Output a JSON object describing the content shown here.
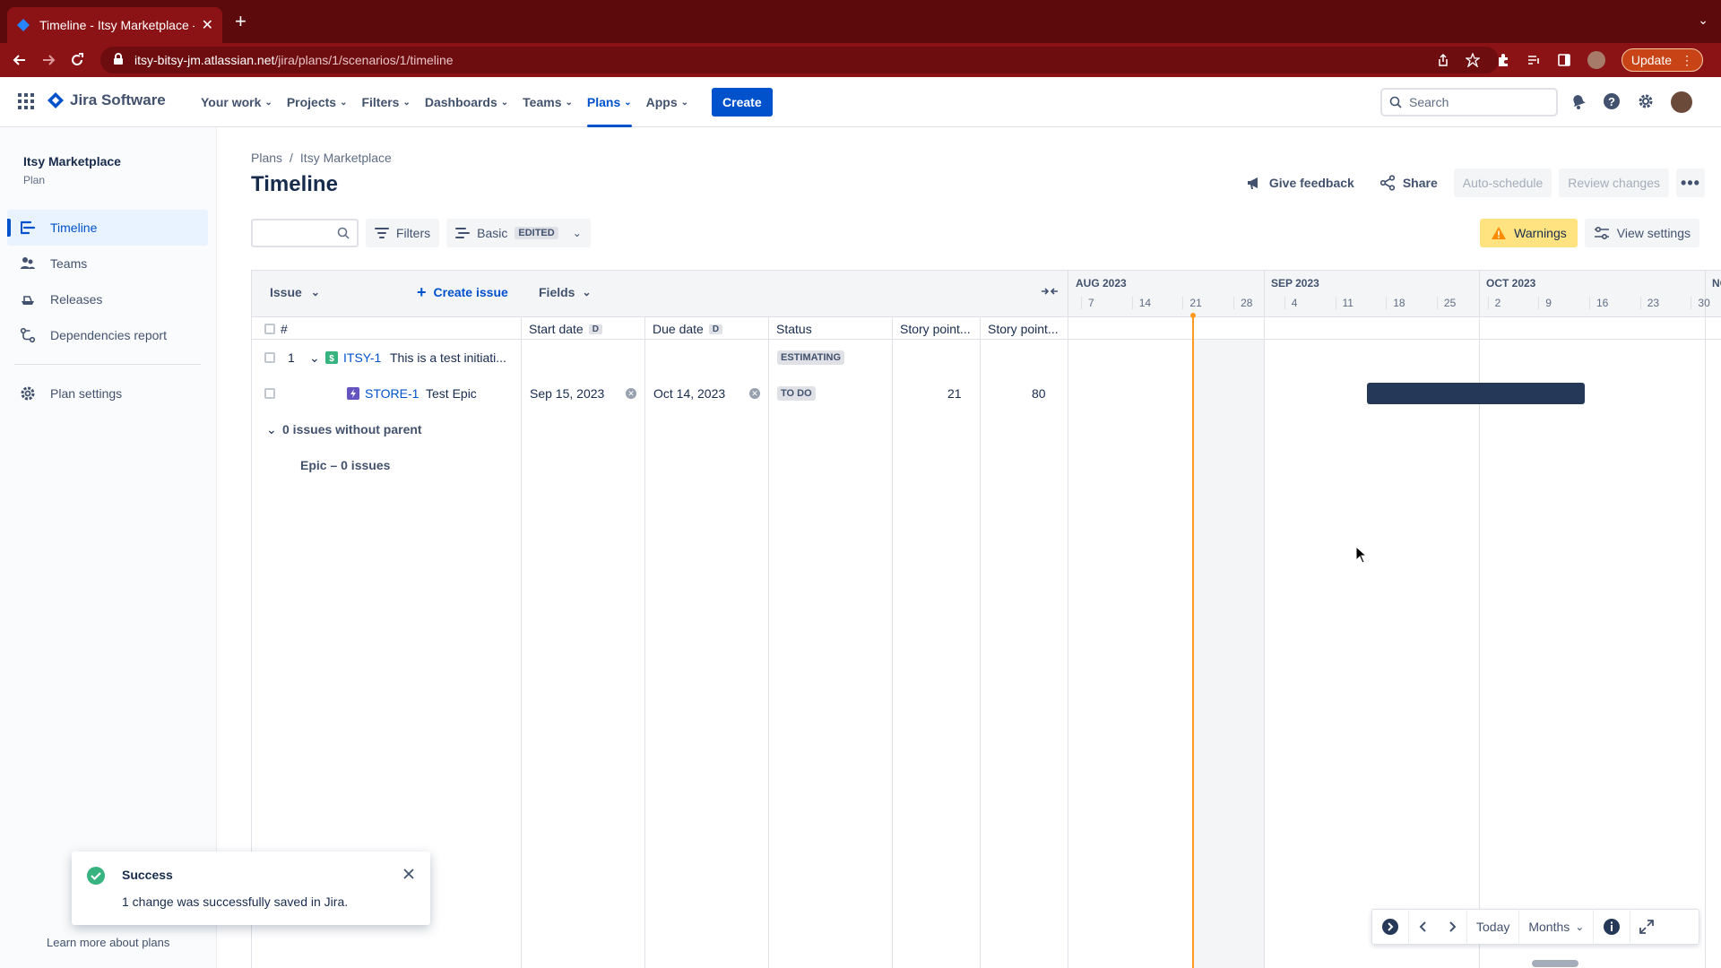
{
  "browser": {
    "tab_title": "Timeline - Itsy Marketplace - A",
    "url_host": "itsy-bitsy-jm.atlassian.net",
    "url_path": "/jira/plans/1/scenarios/1/timeline",
    "update_label": "Update"
  },
  "topnav": {
    "product": "Jira Software",
    "items": [
      {
        "label": "Your work"
      },
      {
        "label": "Projects"
      },
      {
        "label": "Filters"
      },
      {
        "label": "Dashboards"
      },
      {
        "label": "Teams"
      },
      {
        "label": "Plans"
      },
      {
        "label": "Apps"
      }
    ],
    "active_item": "Plans",
    "create_label": "Create",
    "search_placeholder": "Search"
  },
  "sidebar": {
    "project_name": "Itsy Marketplace",
    "project_type": "Plan",
    "items": [
      {
        "label": "Timeline",
        "icon": "timeline-icon"
      },
      {
        "label": "Teams",
        "icon": "people-icon"
      },
      {
        "label": "Releases",
        "icon": "ship-icon"
      },
      {
        "label": "Dependencies report",
        "icon": "dependency-icon"
      }
    ],
    "settings_label": "Plan settings",
    "learn_more": "Learn more about plans"
  },
  "header": {
    "breadcrumb": [
      "Plans",
      "Itsy Marketplace"
    ],
    "title": "Timeline",
    "feedback": "Give feedback",
    "share": "Share",
    "auto_schedule": "Auto-schedule",
    "review_changes": "Review changes"
  },
  "toolbar": {
    "filters": "Filters",
    "view": "Basic",
    "view_badge": "EDITED",
    "warnings": "Warnings",
    "view_settings": "View settings"
  },
  "grid": {
    "issue_header": "Issue",
    "create_issue": "Create issue",
    "fields_header": "Fields",
    "columns": {
      "hash": "#",
      "start": "Start date",
      "due": "Due date",
      "date_badge": "D",
      "status": "Status",
      "sp1": "Story point...",
      "sp2": "Story point..."
    },
    "rows": [
      {
        "num": "1",
        "key": "ITSY-1",
        "summary": "This is a test initiati...",
        "start": "",
        "due": "",
        "status": "ESTIMATING",
        "sp1": "",
        "sp2": ""
      },
      {
        "num": "",
        "key": "STORE-1",
        "summary": "Test Epic",
        "start": "Sep 15, 2023",
        "due": "Oct 14, 2023",
        "status": "TO DO",
        "sp1": "21",
        "sp2": "80"
      }
    ],
    "group_label": "0 issues without parent",
    "subgroup_label": "Epic – 0 issues"
  },
  "timeline": {
    "months": [
      "AUG 2023",
      "SEP 2023",
      "OCT 2023",
      "NO"
    ],
    "weeks": [
      "7",
      "14",
      "21",
      "28",
      "4",
      "11",
      "18",
      "25",
      "2",
      "9",
      "16",
      "23",
      "30"
    ],
    "bar_color": "#253858",
    "today_color": "#ff991f",
    "controls": {
      "today": "Today",
      "scale": "Months"
    }
  },
  "flag": {
    "title": "Success",
    "message": "1 change was successfully saved in Jira."
  }
}
